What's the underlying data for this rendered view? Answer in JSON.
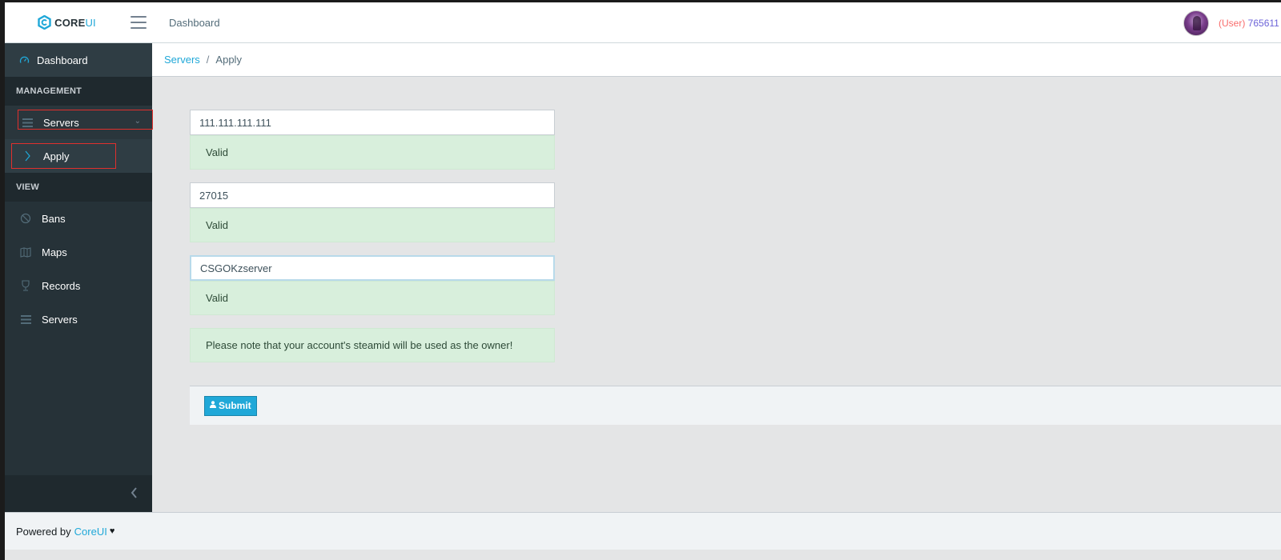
{
  "brand": {
    "core": "CORE",
    "ui": "UI"
  },
  "header": {
    "nav_label": "Dashboard",
    "user_role": "(User)",
    "user_id": "765611"
  },
  "sidebar": {
    "dashboard": "Dashboard",
    "section_management": "MANAGEMENT",
    "servers_dropdown": "Servers",
    "apply": "Apply",
    "section_view": "VIEW",
    "items": [
      {
        "label": "Bans",
        "icon": "ban-icon"
      },
      {
        "label": "Maps",
        "icon": "map-icon"
      },
      {
        "label": "Records",
        "icon": "trophy-icon"
      },
      {
        "label": "Servers",
        "icon": "list-icon"
      }
    ]
  },
  "breadcrumb": {
    "link": "Servers",
    "separator": "/",
    "active": "Apply"
  },
  "form": {
    "ip_value": "111.111.111.111",
    "ip_status": "Valid",
    "port_value": "27015",
    "port_status": "Valid",
    "name_value": "CSGOKzserver",
    "name_status": "Valid",
    "note": "Please note that your account's steamid will be used as the owner!",
    "submit_label": "Submit"
  },
  "footer": {
    "text": "Powered by",
    "link": "CoreUI",
    "heart": "♥"
  },
  "colors": {
    "accent": "#20a8d8",
    "sidebar_bg": "#263238",
    "valid_bg": "#d8efdc",
    "error_red": "#f86c6b"
  }
}
